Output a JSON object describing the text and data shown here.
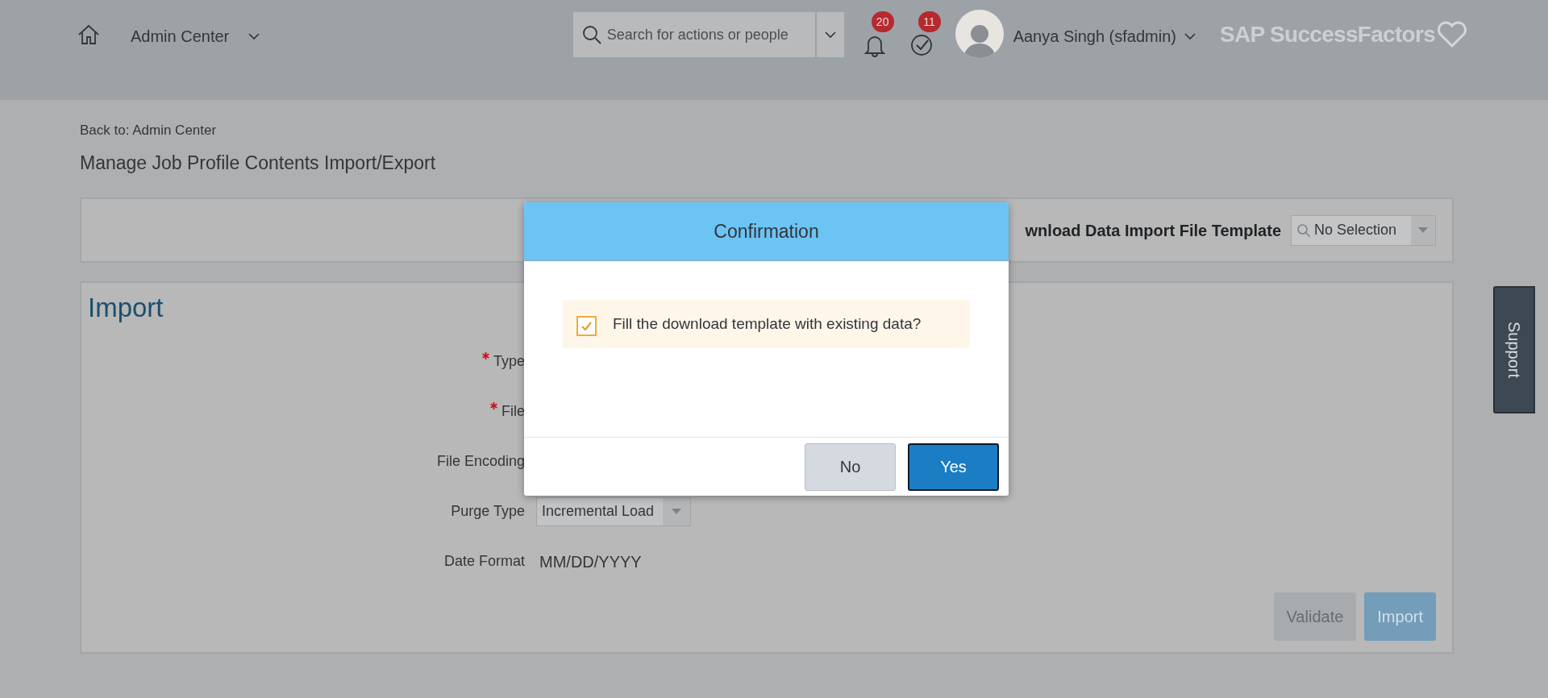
{
  "header": {
    "module": "Admin Center",
    "search": {
      "placeholder": "Search for actions or people"
    },
    "notifications": {
      "count": "20"
    },
    "tasks": {
      "count": "11"
    },
    "user": "Aanya Singh (sfadmin)",
    "logo": "SAP SuccessFactors"
  },
  "back_link": "Back to: Admin Center",
  "page_title": "Manage Job Profile Contents Import/Export",
  "template_panel": {
    "label": "wnload Data Import File Template",
    "select": {
      "value": "No Selection"
    }
  },
  "import_panel": {
    "title": "Import",
    "fields": [
      {
        "label": "Type",
        "required": true,
        "kind": "empty"
      },
      {
        "label": "File",
        "required": true,
        "kind": "empty"
      },
      {
        "label": "File Encoding",
        "required": false,
        "kind": "empty"
      },
      {
        "label": "Purge Type",
        "required": false,
        "kind": "select",
        "value": "Incremental Load"
      },
      {
        "label": "Date Format",
        "required": false,
        "kind": "text",
        "value": "MM/DD/YYYY"
      }
    ],
    "buttons": [
      {
        "label": "Validate",
        "kind": "secondary",
        "disabled": true
      },
      {
        "label": "Import",
        "kind": "primary",
        "disabled": true
      }
    ]
  },
  "support_tab": "Support",
  "dialog": {
    "title": "Confirmation",
    "option": {
      "label": "Fill the download template with existing data?",
      "checked": true
    },
    "buttons": [
      {
        "label": "No",
        "kind": "secondary"
      },
      {
        "label": "Yes",
        "kind": "primary"
      }
    ]
  }
}
